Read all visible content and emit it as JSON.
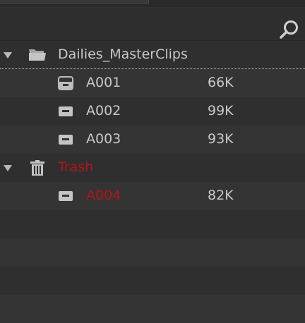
{
  "toolbar": {
    "search_icon": "search-icon"
  },
  "bins": [
    {
      "name": "Dailies_MasterClips",
      "icon": "folder-open-icon",
      "expanded": true
    },
    {
      "name": "Trash",
      "icon": "trash-icon",
      "expanded": true,
      "color": "#b3151b"
    }
  ],
  "clips": [
    {
      "name": "A001",
      "size": "66K",
      "icon": "clip-offline-icon"
    },
    {
      "name": "A002",
      "size": "99K",
      "icon": "clip-icon"
    },
    {
      "name": "A003",
      "size": "93K",
      "icon": "clip-icon"
    },
    {
      "name": "A004",
      "size": "82K",
      "icon": "clip-icon",
      "color": "#b3151b"
    }
  ]
}
